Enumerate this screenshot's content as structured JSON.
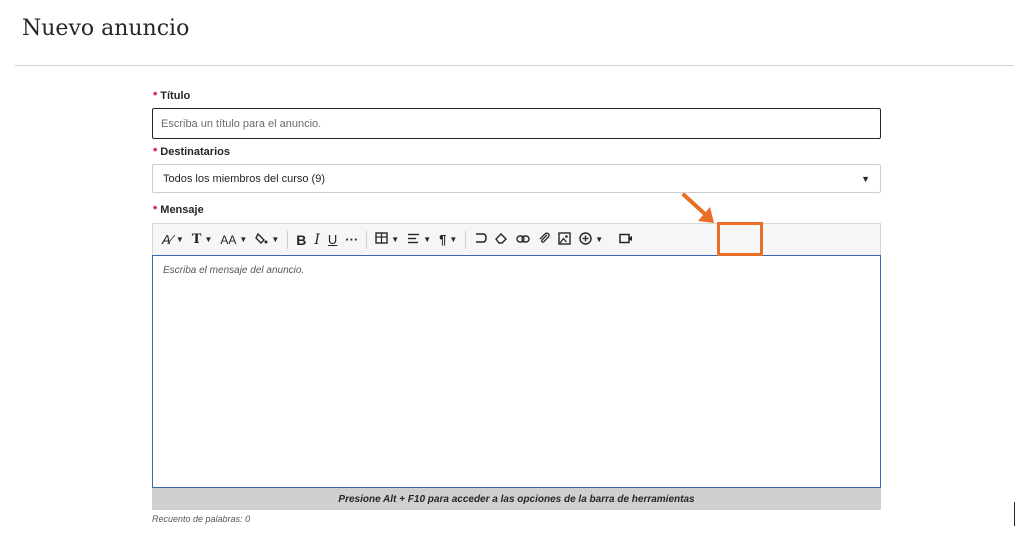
{
  "page": {
    "title": "Nuevo anuncio"
  },
  "form": {
    "required_mark": "*",
    "title_field": {
      "label": "Título",
      "placeholder": "Escriba un título para el anuncio."
    },
    "recipients_field": {
      "label": "Destinatarios",
      "selected": "Todos los miembros del curso (9)"
    },
    "message_field": {
      "label": "Mensaje",
      "placeholder": "Escriba el mensaje del anuncio.",
      "toolbar_hint": "Presione Alt + F10 para acceder a las opciones de la barra de herramientas",
      "word_count": "Recuento de palabras: 0"
    }
  },
  "toolbar": {
    "glyphs": {
      "bold": "B",
      "italic": "I",
      "underline": "U",
      "more": "···",
      "paragraph": "¶"
    },
    "icons": [
      "text-style-icon",
      "font-family-icon",
      "font-size-icon",
      "text-color-icon",
      "bold-icon",
      "italic-icon",
      "underline-icon",
      "more-icon",
      "table-icon",
      "align-icon",
      "paragraph-icon",
      "undo-icon",
      "clear-format-icon",
      "link-icon",
      "attachment-icon",
      "image-icon",
      "insert-content-icon",
      "video-icon"
    ]
  },
  "colors": {
    "highlight": "#e96f28",
    "required": "#c8102e",
    "editor_border": "#3a65b8"
  }
}
